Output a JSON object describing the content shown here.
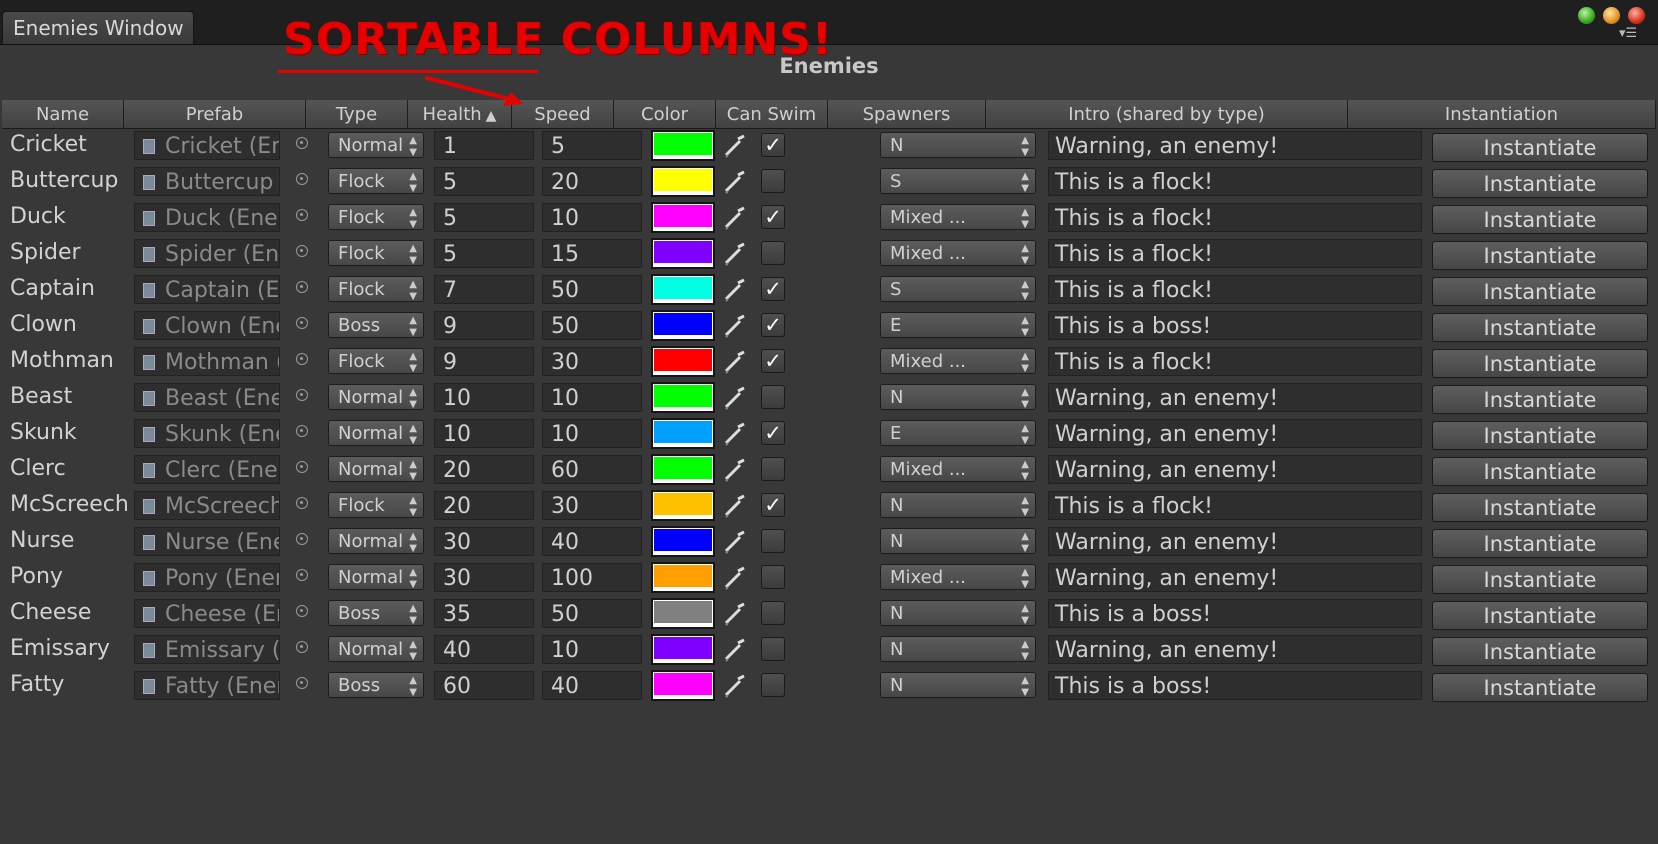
{
  "window": {
    "tab_title": "Enemies Window",
    "pane_title": "Enemies"
  },
  "annotation": {
    "text": "SORTABLE COLUMNS!",
    "color": "#e60000"
  },
  "columns": [
    "Name",
    "Prefab",
    "Type",
    "Health",
    "Speed",
    "Color",
    "Can Swim",
    "Spawners",
    "Intro (shared by type)",
    "Instantiation"
  ],
  "sort": {
    "column": "Health",
    "direction": "ascending",
    "arrow": "▲"
  },
  "instantiate_label": "Instantiate",
  "rows": [
    {
      "name": "Cricket",
      "prefab": "Cricket (En",
      "type": "Normal",
      "health": "1",
      "speed": "5",
      "color": "#00ff00",
      "can_swim": true,
      "spawners": "N",
      "intro": "Warning, an enemy!"
    },
    {
      "name": "Buttercup",
      "prefab": "Buttercup (",
      "type": "Flock",
      "health": "5",
      "speed": "20",
      "color": "#ffff00",
      "can_swim": false,
      "spawners": "S",
      "intro": "This is a flock!"
    },
    {
      "name": "Duck",
      "prefab": "Duck (Ener",
      "type": "Flock",
      "health": "5",
      "speed": "10",
      "color": "#ff00ff",
      "can_swim": true,
      "spawners": "Mixed ...",
      "intro": "This is a flock!"
    },
    {
      "name": "Spider",
      "prefab": "Spider (Ene",
      "type": "Flock",
      "health": "5",
      "speed": "15",
      "color": "#8000ff",
      "can_swim": false,
      "spawners": "Mixed ...",
      "intro": "This is a flock!"
    },
    {
      "name": "Captain",
      "prefab": "Captain (Er",
      "type": "Flock",
      "health": "7",
      "speed": "50",
      "color": "#00ffe0",
      "can_swim": true,
      "spawners": "S",
      "intro": "This is a flock!"
    },
    {
      "name": "Clown",
      "prefab": "Clown (Ene",
      "type": "Boss",
      "health": "9",
      "speed": "50",
      "color": "#0000ff",
      "can_swim": true,
      "spawners": "E",
      "intro": "This is a boss!"
    },
    {
      "name": "Mothman",
      "prefab": "Mothman (",
      "type": "Flock",
      "health": "9",
      "speed": "30",
      "color": "#ff0000",
      "can_swim": true,
      "spawners": "Mixed ...",
      "intro": "This is a flock!"
    },
    {
      "name": "Beast",
      "prefab": "Beast (Ener",
      "type": "Normal",
      "health": "10",
      "speed": "10",
      "color": "#00ff00",
      "can_swim": false,
      "spawners": "N",
      "intro": "Warning, an enemy!"
    },
    {
      "name": "Skunk",
      "prefab": "Skunk (Ene",
      "type": "Normal",
      "health": "10",
      "speed": "10",
      "color": "#00a0ff",
      "can_swim": true,
      "spawners": "E",
      "intro": "Warning, an enemy!"
    },
    {
      "name": "Clerc",
      "prefab": "Clerc (Ener",
      "type": "Normal",
      "health": "20",
      "speed": "60",
      "color": "#00ff00",
      "can_swim": false,
      "spawners": "Mixed ...",
      "intro": "Warning, an enemy!"
    },
    {
      "name": "McScreech",
      "prefab": "McScreech",
      "type": "Flock",
      "health": "20",
      "speed": "30",
      "color": "#ffc000",
      "can_swim": true,
      "spawners": "N",
      "intro": "This is a flock!"
    },
    {
      "name": "Nurse",
      "prefab": "Nurse (Ene",
      "type": "Normal",
      "health": "30",
      "speed": "40",
      "color": "#0000ff",
      "can_swim": false,
      "spawners": "N",
      "intro": "Warning, an enemy!"
    },
    {
      "name": "Pony",
      "prefab": "Pony (Ener",
      "type": "Normal",
      "health": "30",
      "speed": "100",
      "color": "#ffa000",
      "can_swim": false,
      "spawners": "Mixed ...",
      "intro": "Warning, an enemy!"
    },
    {
      "name": "Cheese",
      "prefab": "Cheese (Er",
      "type": "Boss",
      "health": "35",
      "speed": "50",
      "color": "#808080",
      "can_swim": false,
      "spawners": "N",
      "intro": "This is a boss!"
    },
    {
      "name": "Emissary",
      "prefab": "Emissary (",
      "type": "Normal",
      "health": "40",
      "speed": "10",
      "color": "#8000ff",
      "can_swim": false,
      "spawners": "N",
      "intro": "Warning, an enemy!"
    },
    {
      "name": "Fatty",
      "prefab": "Fatty (Ener",
      "type": "Boss",
      "health": "60",
      "speed": "40",
      "color": "#ff00ff",
      "can_swim": false,
      "spawners": "N",
      "intro": "This is a boss!"
    }
  ]
}
